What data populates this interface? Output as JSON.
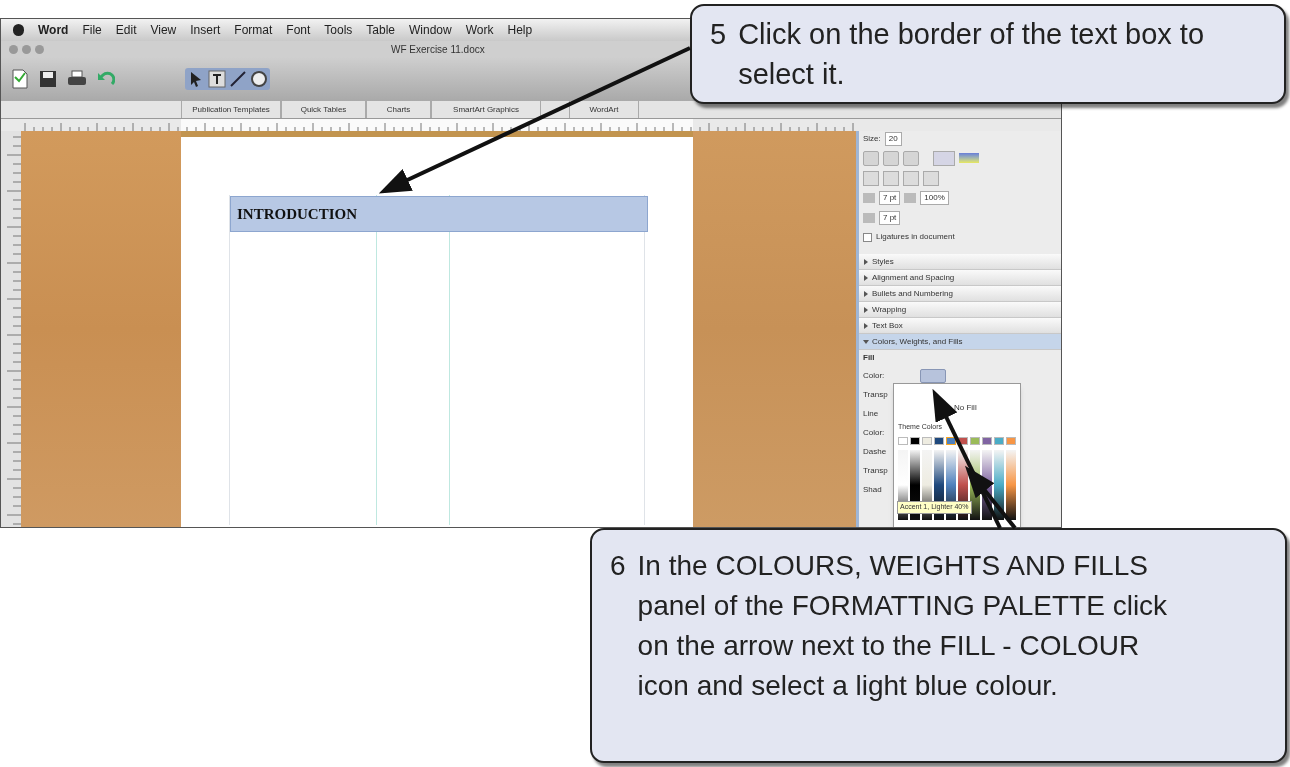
{
  "menu_bar": {
    "items": [
      "Word",
      "File",
      "Edit",
      "View",
      "Insert",
      "Format",
      "Font",
      "Tools",
      "Table",
      "Window",
      "Work",
      "Help"
    ]
  },
  "window": {
    "title": "WF Exercise 11.docx"
  },
  "gallery_tabs": [
    "Publication Templates",
    "Quick Tables",
    "Charts",
    "SmartArt Graphics",
    "WordArt"
  ],
  "document": {
    "text_box": {
      "text": "INTRODUCTION",
      "selected": true
    }
  },
  "formatting_palette": {
    "size_label": "Size:",
    "size": "20",
    "spacing_1": "7 pt",
    "scale": "100%",
    "spacing_2": "7 pt",
    "ligatures": {
      "label": "Ligatures in document",
      "checked": false
    },
    "sections": [
      {
        "label": "Styles",
        "expanded": false
      },
      {
        "label": "Alignment and Spacing",
        "expanded": false
      },
      {
        "label": "Bullets and Numbering",
        "expanded": false
      },
      {
        "label": "Wrapping",
        "expanded": false
      },
      {
        "label": "Text Box",
        "expanded": false
      },
      {
        "label": "Colors, Weights, and Fills",
        "expanded": true
      }
    ],
    "fill_heading": "Fill",
    "fields": [
      "Color:",
      "Transp",
      "Line",
      "Color:",
      "Dashe",
      "Transp",
      "Shad"
    ],
    "color_menu": {
      "no_fill": "No Fill",
      "theme_heading": "Theme Colors",
      "tooltip": "Accent 1, Lighter 40%",
      "swatches": [
        {
          "color": "#ffffff",
          "selected": false
        },
        {
          "color": "#000000",
          "selected": false
        },
        {
          "color": "#eeece1",
          "selected": false
        },
        {
          "color": "#1f497d",
          "selected": false
        },
        {
          "color": "#4f81bd",
          "selected": true
        },
        {
          "color": "#c0504d",
          "selected": false
        },
        {
          "color": "#9bbb59",
          "selected": false
        },
        {
          "color": "#8064a2",
          "selected": false
        },
        {
          "color": "#4bacc6",
          "selected": false
        },
        {
          "color": "#f79646",
          "selected": false
        }
      ]
    }
  },
  "callouts": [
    {
      "number": "5",
      "text": "Click on the border of the text box to select it."
    },
    {
      "number": "6",
      "text": "In the COLOURS, WEIGHTS AND FILLS panel of the FORMATTING PALETTE click on the arrow next to the FILL - COLOUR icon and select a light blue colour."
    }
  ]
}
